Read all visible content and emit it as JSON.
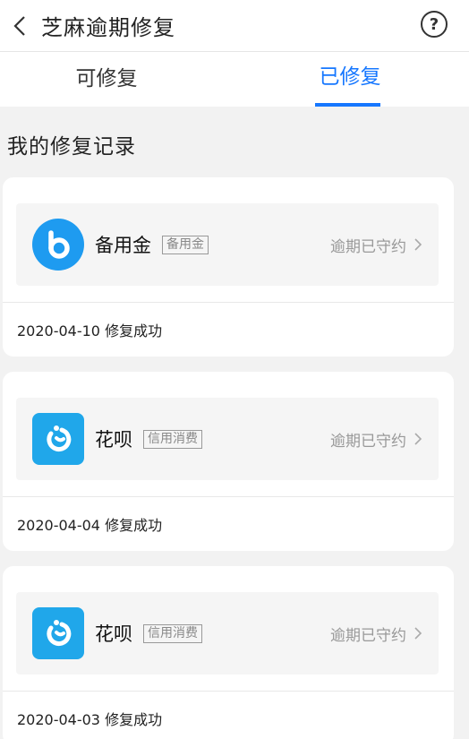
{
  "header": {
    "title": "芝麻逾期修复",
    "help_symbol": "?"
  },
  "tabs": [
    {
      "label": "可修复",
      "active": false
    },
    {
      "label": "已修复",
      "active": true
    }
  ],
  "section_title": "我的修复记录",
  "records": [
    {
      "app_name": "备用金",
      "tag": "备用金",
      "status": "逾期已守约",
      "icon": "beiyongjin-icon",
      "date_text": "2020-04-10 修复成功"
    },
    {
      "app_name": "花呗",
      "tag": "信用消费",
      "status": "逾期已守约",
      "icon": "huabei-icon",
      "date_text": "2020-04-04 修复成功"
    },
    {
      "app_name": "花呗",
      "tag": "信用消费",
      "status": "逾期已守约",
      "icon": "huabei-icon",
      "date_text": "2020-04-03 修复成功"
    }
  ],
  "colors": {
    "accent": "#1677ff",
    "background": "#f2f2f2",
    "icon_blue": "#1e9bf0"
  }
}
